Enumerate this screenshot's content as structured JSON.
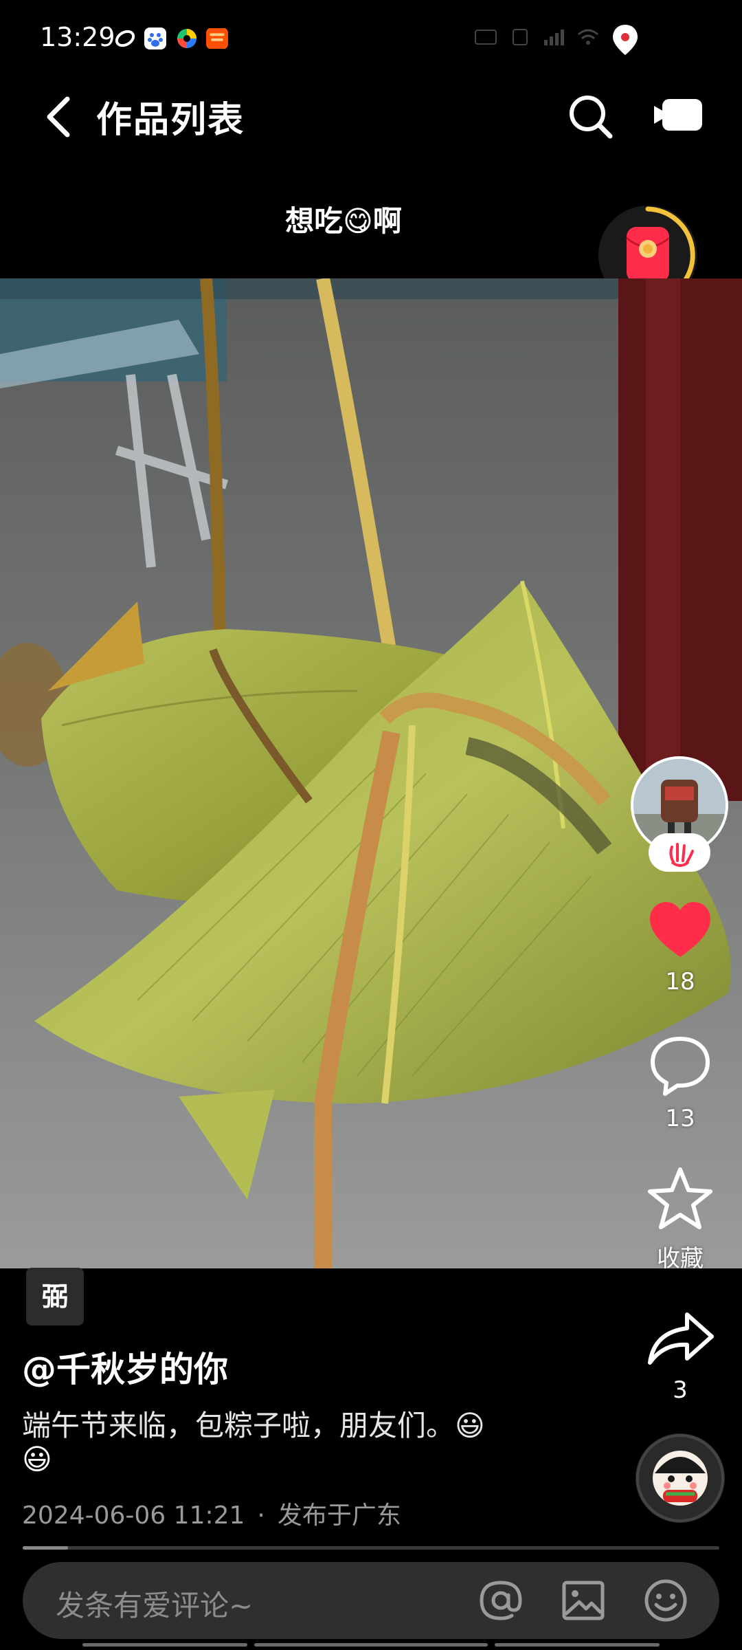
{
  "status_bar": {
    "time": "13:29"
  },
  "header": {
    "title": "作品列表",
    "back_icon": "chevron-left-icon",
    "search_icon": "search-icon",
    "camera_icon": "video-camera-icon"
  },
  "caption": {
    "text_before": "想吃",
    "emoji": "😋",
    "text_after": "啊"
  },
  "actions": {
    "likes": "18",
    "comments": "13",
    "favorite_label": "收藏",
    "shares": "3"
  },
  "post": {
    "tag": "弼",
    "author": "@千秋岁的你",
    "description_line1": "端午节来临，包粽子啦，朋友们。😃",
    "description_line2": "😃",
    "date": "2024-06-06 11:21",
    "separator": "·",
    "location": "发布于广东",
    "progress": 0.065
  },
  "comment_bar": {
    "placeholder": "发条有爱评论~"
  },
  "colors": {
    "accent_red": "#ff2d4a",
    "gold": "#f4c13a",
    "background": "#000000"
  }
}
